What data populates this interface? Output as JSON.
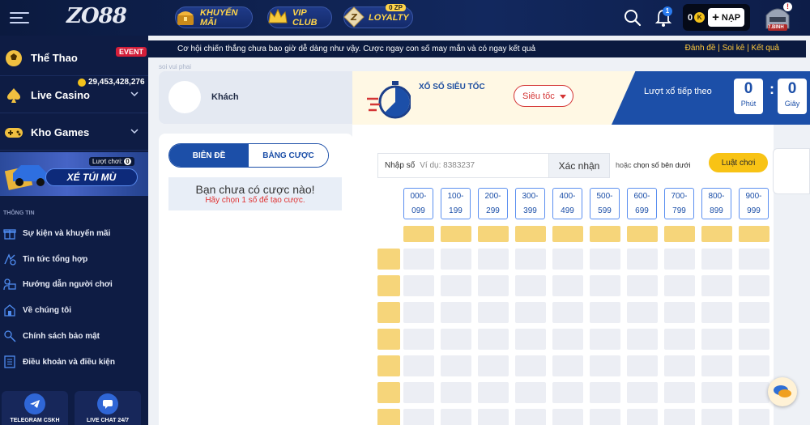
{
  "header": {
    "logo": "ZO88",
    "nav": {
      "promo": "KHUYẾN MÃI",
      "vip": "VIP CLUB",
      "loyalty": "LOYALTY",
      "loyalty_badge": "0 ZP"
    },
    "notification_count": "1",
    "wallet_balance": "0",
    "wallet_currency": "K",
    "deposit_label": "NẠP",
    "rank_label": "7.BINH"
  },
  "sidebar": {
    "games": [
      {
        "label": "Thể Thao",
        "icon": "soccer-ball-icon",
        "tag": "EVENT"
      },
      {
        "label": "Live Casino",
        "icon": "spade-icon"
      },
      {
        "label": "Kho Games",
        "icon": "gamepad-icon"
      }
    ],
    "jackpot": "29,453,428,276",
    "promo_banner": {
      "title": "XÉ TÚI MÙ",
      "turns_label": "Lượt chơi:",
      "turns": "0"
    },
    "section_title": "THÔNG TIN",
    "links": [
      {
        "label": "Sự kiện và khuyến mãi",
        "icon": "gift-icon"
      },
      {
        "label": "Tin tức tổng hợp",
        "icon": "news-icon"
      },
      {
        "label": "Hướng dẫn người chơi",
        "icon": "guide-icon"
      },
      {
        "label": "Về chúng tôi",
        "icon": "home-icon"
      },
      {
        "label": "Chính sách bảo mật",
        "icon": "security-icon"
      },
      {
        "label": "Điều khoản và điều kiện",
        "icon": "document-icon"
      }
    ],
    "footer": [
      {
        "label": "TELEGRAM CSKH",
        "icon": "telegram-icon"
      },
      {
        "label": "LIVE CHAT 24/7",
        "icon": "chat-icon"
      }
    ]
  },
  "marquee": {
    "text": "Cơ hội chiến thắng chưa bao giờ dễ dàng như vậy. Cược ngay con số may mắn và có ngay kết quả",
    "links": [
      "Đánh đề",
      "Soi kê",
      "Kết quả"
    ],
    "ghost": "soi vui phai"
  },
  "user": {
    "name": "Khách"
  },
  "bets": {
    "tabs": [
      "BIÊN ĐỀ",
      "BẢNG CƯỢC"
    ],
    "empty_title": "Bạn chưa có cược nào!",
    "empty_hint": "Hãy chọn 1 số để tạo cược."
  },
  "lottery": {
    "title": "XỔ SỐ SIÊU TỐC",
    "mode": "Siêu tốc",
    "next_draw_label": "Lượt xổ tiếp theo",
    "minutes": "0",
    "minutes_label": "Phút",
    "seconds": "0",
    "seconds_label": "Giây",
    "input_label": "Nhập số",
    "input_placeholder": "Ví dụ: 8383237",
    "confirm_label": "Xác nhận",
    "or_prefix": "hoặc",
    "or_text": "chọn số bên dưới",
    "rules_label": "Luật chơi",
    "ranges": [
      [
        "000-",
        "099"
      ],
      [
        "100-",
        "199"
      ],
      [
        "200-",
        "299"
      ],
      [
        "300-",
        "399"
      ],
      [
        "400-",
        "499"
      ],
      [
        "500-",
        "599"
      ],
      [
        "600-",
        "699"
      ],
      [
        "700-",
        "799"
      ],
      [
        "800-",
        "899"
      ],
      [
        "900-",
        "999"
      ]
    ]
  }
}
